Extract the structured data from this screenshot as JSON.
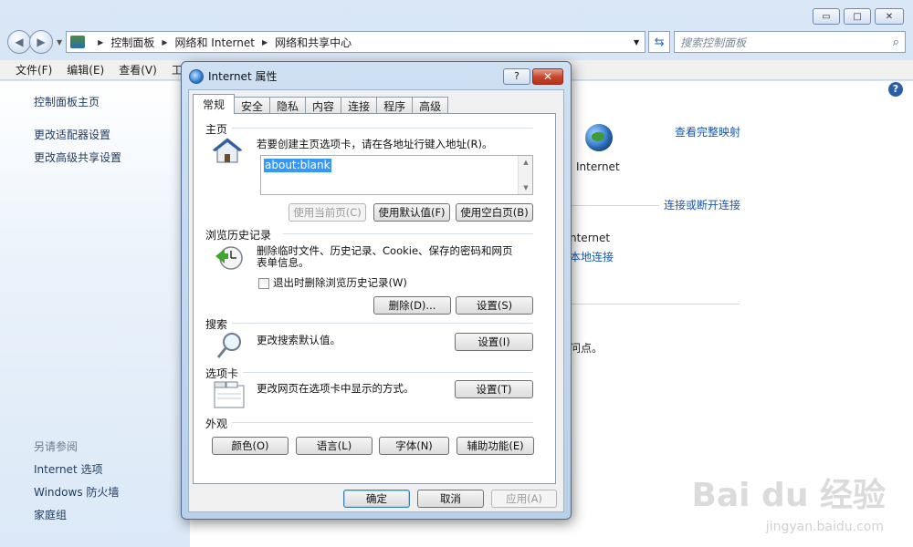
{
  "window": {
    "controls": {
      "minimize": "▭",
      "maximize": "□",
      "close": "✕"
    }
  },
  "address_bar": {
    "breadcrumbs": [
      "控制面板",
      "网络和 Internet",
      "网络和共享中心"
    ],
    "search_placeholder": "搜索控制面板"
  },
  "menu": [
    "文件(F)",
    "编辑(E)",
    "查看(V)",
    "工"
  ],
  "sidebar": {
    "links": [
      "控制面板主页",
      "更改适配器设置",
      "更改高级共享设置"
    ],
    "see_also_title": "另请参阅",
    "see_also": [
      "Internet 选项",
      "Windows 防火墙",
      "家庭组"
    ]
  },
  "content": {
    "view_full_map": "查看完整映射",
    "internet_label": "Internet",
    "connect_disconnect": "连接或断开连接",
    "partial_internet": "nternet",
    "partial_local": "本地连接",
    "partial_point": "问点。"
  },
  "dialog": {
    "title": "Internet 属性",
    "help": "?",
    "close": "✕",
    "tabs": [
      "常规",
      "安全",
      "隐私",
      "内容",
      "连接",
      "程序",
      "高级"
    ],
    "home": {
      "label": "主页",
      "desc": "若要创建主页选项卡，请在各地址行键入地址(R)。",
      "value": "about:blank",
      "btn_current": "使用当前页(C)",
      "btn_default": "使用默认值(F)",
      "btn_blank": "使用空白页(B)"
    },
    "history": {
      "label": "浏览历史记录",
      "desc_line1": "删除临时文件、历史记录、Cookie、保存的密码和网页",
      "desc_line2": "表单信息。",
      "checkbox": "退出时删除浏览历史记录(W)",
      "btn_delete": "删除(D)...",
      "btn_settings": "设置(S)"
    },
    "search": {
      "label": "搜索",
      "desc": "更改搜索默认值。",
      "btn_settings": "设置(I)"
    },
    "tabs_group": {
      "label": "选项卡",
      "desc": "更改网页在选项卡中显示的方式。",
      "btn_settings": "设置(T)"
    },
    "appearance": {
      "label": "外观",
      "btn_colors": "颜色(O)",
      "btn_languages": "语言(L)",
      "btn_fonts": "字体(N)",
      "btn_accessibility": "辅助功能(E)"
    },
    "footer": {
      "ok": "确定",
      "cancel": "取消",
      "apply": "应用(A)"
    }
  },
  "watermark": {
    "text": "Bai du 经验",
    "sub": "jingyan.baidu.com"
  }
}
